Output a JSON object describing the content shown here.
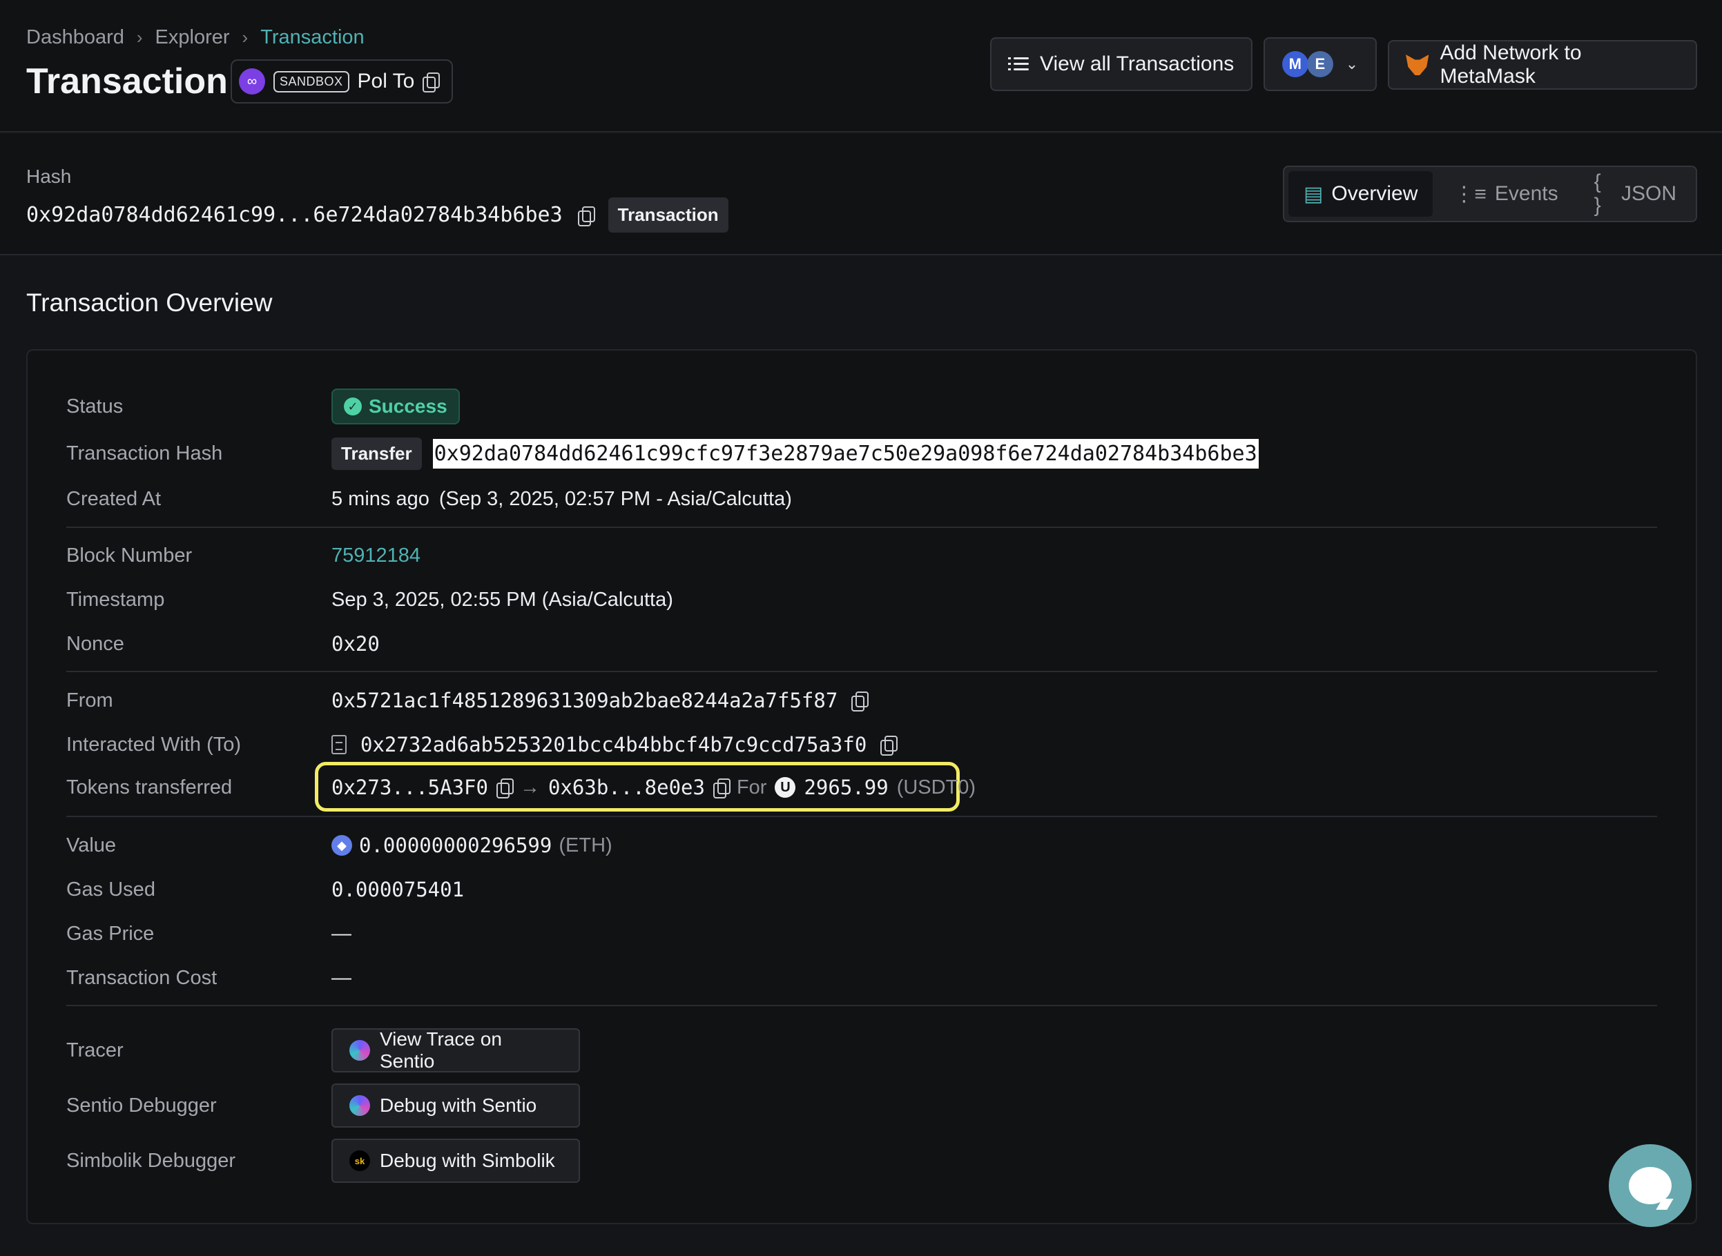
{
  "breadcrumb": {
    "items": [
      "Dashboard",
      "Explorer",
      "Transaction"
    ]
  },
  "header": {
    "title": "Transaction",
    "chain": {
      "sandbox_label": "SANDBOX",
      "name": "Pol To"
    },
    "view_all_label": "View all Transactions",
    "network_badges": [
      "M",
      "E"
    ],
    "metamask_label": "Add Network to MetaMask"
  },
  "hash_strip": {
    "label": "Hash",
    "value": "0x92da0784dd62461c99...6e724da02784b34b6be3",
    "tag": "Transaction",
    "tabs": [
      {
        "label": "Overview",
        "icon": "overview-icon",
        "active": true
      },
      {
        "label": "Events",
        "icon": "events-icon",
        "active": false
      },
      {
        "label": "JSON",
        "icon": "json-icon",
        "active": false
      }
    ]
  },
  "overview": {
    "title": "Transaction Overview",
    "status": {
      "label": "Status",
      "value": "Success"
    },
    "tx_hash": {
      "label": "Transaction Hash",
      "tag": "Transfer",
      "value": "0x92da0784dd62461c99cfc97f3e2879ae7c50e29a098f6e724da02784b34b6be3"
    },
    "created_at": {
      "label": "Created At",
      "relative": "5 mins ago",
      "absolute": "(Sep 3, 2025, 02:57 PM - Asia/Calcutta)"
    },
    "block_number": {
      "label": "Block Number",
      "value": "75912184"
    },
    "timestamp": {
      "label": "Timestamp",
      "value": "Sep 3, 2025, 02:55 PM (Asia/Calcutta)"
    },
    "nonce": {
      "label": "Nonce",
      "value": "0x20"
    },
    "from": {
      "label": "From",
      "value": "0x5721ac1f4851289631309ab2bae8244a2a7f5f87"
    },
    "to": {
      "label": "Interacted With (To)",
      "value": "0x2732ad6ab5253201bcc4b4bbcf4b7c9ccd75a3f0"
    },
    "tokens": {
      "label": "Tokens transferred",
      "from": "0x273...5A3F0",
      "to": "0x63b...8e0e3",
      "for_label": "For",
      "amount": "2965.99",
      "symbol": "(USDT0)",
      "token_badge": "U"
    },
    "value": {
      "label": "Value",
      "amount": "0.00000000296599",
      "unit": "(ETH)"
    },
    "gas_used": {
      "label": "Gas Used",
      "value": "0.000075401"
    },
    "gas_price": {
      "label": "Gas Price",
      "value": "—"
    },
    "tx_cost": {
      "label": "Transaction Cost",
      "value": "—"
    },
    "tracer": {
      "label": "Tracer",
      "button": "View Trace on Sentio"
    },
    "sentio_debugger": {
      "label": "Sentio Debugger",
      "button": "Debug with Sentio"
    },
    "simbolik_debugger": {
      "label": "Simbolik Debugger",
      "button": "Debug with Simbolik",
      "logo_text": "sk"
    }
  },
  "colors": {
    "accent": "#4fb3b4",
    "success": "#4fd1a5",
    "highlight_border": "#f2ec64",
    "background": "#141518"
  }
}
